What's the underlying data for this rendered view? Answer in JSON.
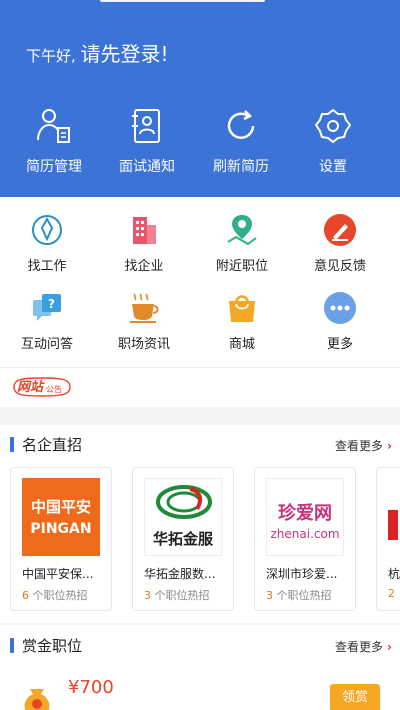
{
  "header": {
    "greeting_small": "下午好, ",
    "greeting_big": "请先登录!",
    "items": [
      {
        "label": "简历管理",
        "icon": "resume-user-icon"
      },
      {
        "label": "面试通知",
        "icon": "interview-notice-icon"
      },
      {
        "label": "刷新简历",
        "icon": "refresh-icon"
      },
      {
        "label": "设置",
        "icon": "gear-icon"
      }
    ]
  },
  "grid": {
    "items": [
      {
        "label": "找工作",
        "icon": "find-job-icon"
      },
      {
        "label": "找企业",
        "icon": "building-icon"
      },
      {
        "label": "附近职位",
        "icon": "map-pin-icon"
      },
      {
        "label": "意见反馈",
        "icon": "feedback-pen-icon"
      },
      {
        "label": "互动问答",
        "icon": "question-chat-icon"
      },
      {
        "label": "职场资讯",
        "icon": "coffee-cup-icon"
      },
      {
        "label": "商城",
        "icon": "shopping-bag-icon"
      },
      {
        "label": "更多",
        "icon": "more-dots-icon"
      }
    ]
  },
  "notice": {
    "tag_main": "网站",
    "tag_sub": "公告"
  },
  "famous": {
    "title": "名企直招",
    "more": "查看更多",
    "cards": [
      {
        "name": "中国平安保...",
        "jobs_count": "6",
        "jobs_suffix": " 个职位热招",
        "logo_line1": "中国平安",
        "logo_line2": "PINGAN"
      },
      {
        "name": "华拓金服数...",
        "jobs_count": "3",
        "jobs_suffix": " 个职位热招",
        "logo_text": "华拓金服"
      },
      {
        "name": "深圳市珍爱...",
        "jobs_count": "3",
        "jobs_suffix": " 个职位热招",
        "logo_line1": "珍爱网",
        "logo_line2": "zhenai.com"
      },
      {
        "name": "杭",
        "jobs_count": "2"
      }
    ]
  },
  "reward": {
    "title": "赏金职位",
    "more": "查看更多",
    "price": "¥700",
    "button": "领赏"
  },
  "colors": {
    "primary": "#3b73d6",
    "accent": "#e8452a",
    "orange": "#e07b17"
  }
}
